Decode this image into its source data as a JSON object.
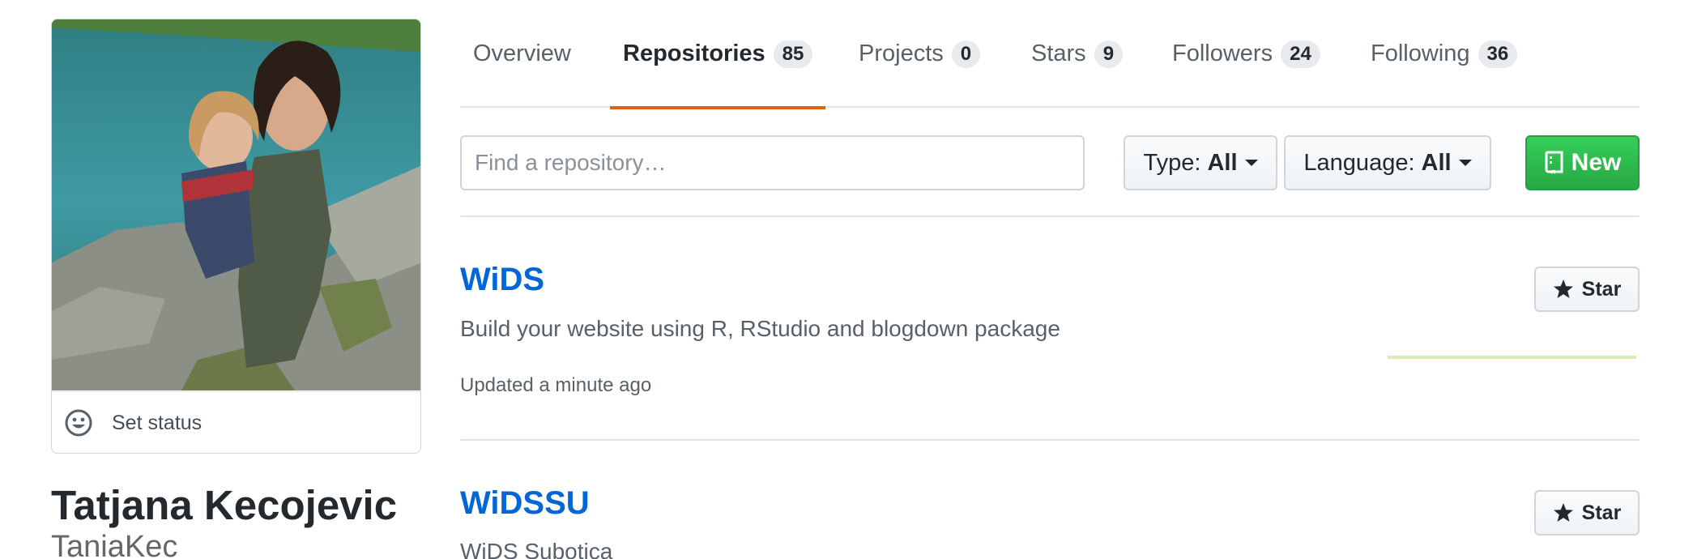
{
  "profile": {
    "full_name": "Tatjana Kecojevic",
    "username": "TaniaKec",
    "status_label": "Set status",
    "avatar_alt": "Tatjana Kecojevic"
  },
  "tabs": [
    {
      "label": "Overview",
      "count": null,
      "selected": false
    },
    {
      "label": "Repositories",
      "count": "85",
      "selected": true
    },
    {
      "label": "Projects",
      "count": "0",
      "selected": false
    },
    {
      "label": "Stars",
      "count": "9",
      "selected": false
    },
    {
      "label": "Followers",
      "count": "24",
      "selected": false
    },
    {
      "label": "Following",
      "count": "36",
      "selected": false
    }
  ],
  "filters": {
    "search_placeholder": "Find a repository…",
    "type_label": "Type:",
    "type_value": "All",
    "language_label": "Language:",
    "language_value": "All",
    "new_label": "New"
  },
  "repos": [
    {
      "name": "WiDS",
      "description": "Build your website using R, RStudio and blogdown package",
      "updated": "Updated a minute ago",
      "star_label": "Star"
    },
    {
      "name": "WiDSSU",
      "description": "WiDS Subotica",
      "updated": "",
      "star_label": "Star"
    }
  ],
  "colors": {
    "accent_tab": "#e36209",
    "link": "#0366d6",
    "new_button": "#28a745"
  }
}
